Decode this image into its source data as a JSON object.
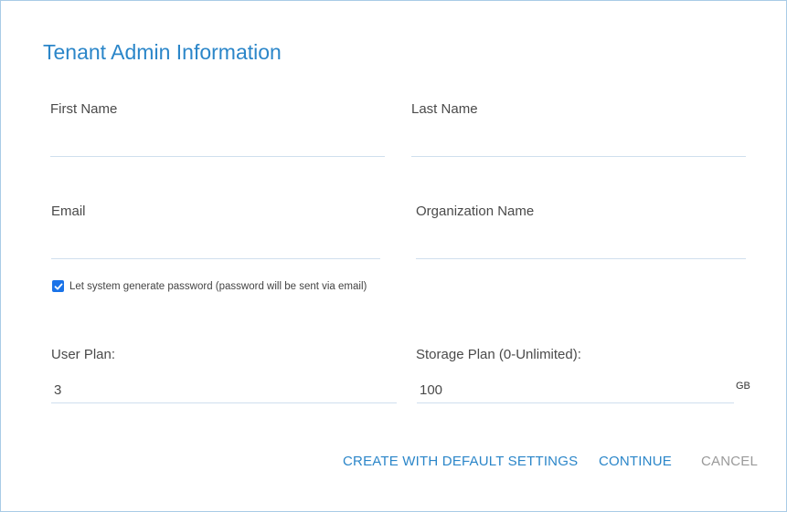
{
  "dialog": {
    "title": "Tenant Admin Information",
    "fields": {
      "first_name": {
        "label": "First Name",
        "value": ""
      },
      "last_name": {
        "label": "Last Name",
        "value": ""
      },
      "email": {
        "label": "Email",
        "value": ""
      },
      "organization_name": {
        "label": "Organization Name",
        "value": ""
      },
      "user_plan": {
        "label": "User Plan:",
        "value": "3"
      },
      "storage_plan": {
        "label": "Storage Plan (0-Unlimited):",
        "value": "100",
        "unit": "GB"
      }
    },
    "password_option": {
      "label": "Let system generate password (password will be sent via email)",
      "checked": true
    },
    "buttons": {
      "create_default": "CREATE WITH DEFAULT SETTINGS",
      "continue": "CONTINUE",
      "cancel": "CANCEL"
    }
  },
  "colors": {
    "accent": "#2b86c9",
    "checkbox": "#1a73e8",
    "muted": "#9a9a9a",
    "border": "#a9cbe6"
  }
}
